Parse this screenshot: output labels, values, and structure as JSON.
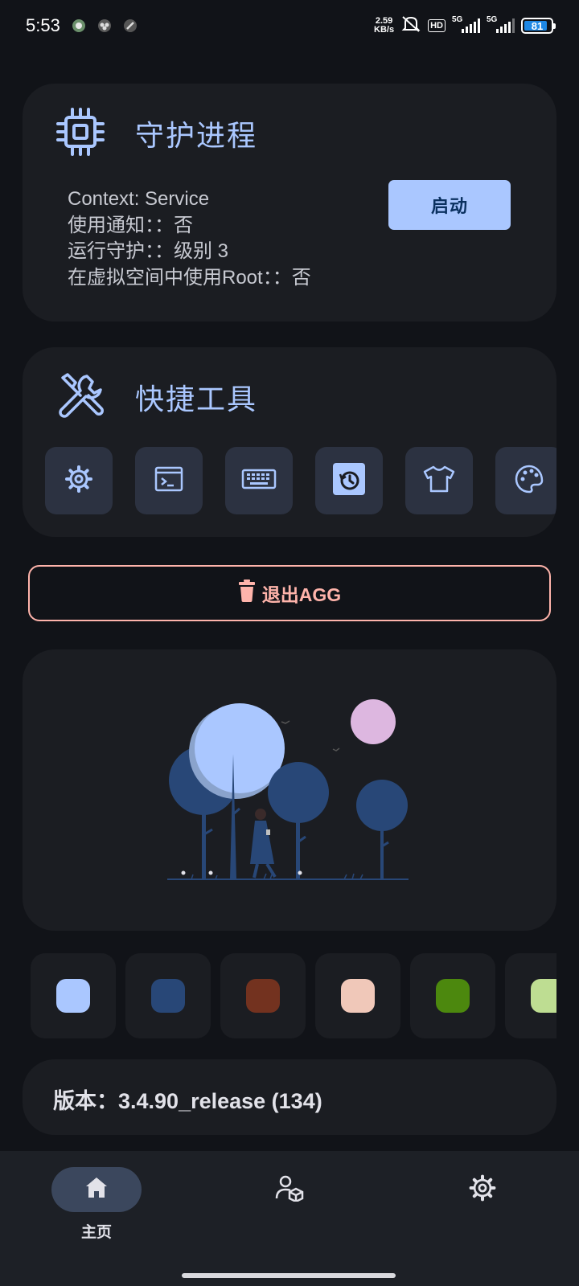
{
  "status_bar": {
    "time": "5:53",
    "net_speed_value": "2.59",
    "net_speed_unit": "KB/s",
    "hd_label": "HD",
    "signal1_label": "5G",
    "signal2_label": "5G",
    "battery_level": "81"
  },
  "guard_card": {
    "title": "守护进程",
    "icon": "cpu-chip-icon",
    "lines": [
      "Context: Service",
      "使用通知：：否",
      "运行守护：：级别 3",
      "在虚拟空间中使用Root：：否"
    ],
    "start_label": "启动"
  },
  "tools_card": {
    "title": "快捷工具",
    "icon": "wrench-screwdriver-icon",
    "tools": [
      "gear-icon",
      "terminal-icon",
      "keyboard-icon",
      "history-clock-icon",
      "tshirt-icon",
      "palette-icon"
    ]
  },
  "exit_label": "退出AGG",
  "swatches": [
    "#aac7ff",
    "#284777",
    "#73321f",
    "#f0c8b9",
    "#4c880e",
    "#bedd92"
  ],
  "version": "版本：3.4.90_release (134)",
  "nav": {
    "home_label": "主页",
    "items": [
      "home-icon",
      "user-package-icon",
      "settings-icon"
    ]
  },
  "colors": {
    "accent": "#aac7ff",
    "error": "#ffb4ab",
    "background": "#111318",
    "card": "#1b1d22"
  }
}
